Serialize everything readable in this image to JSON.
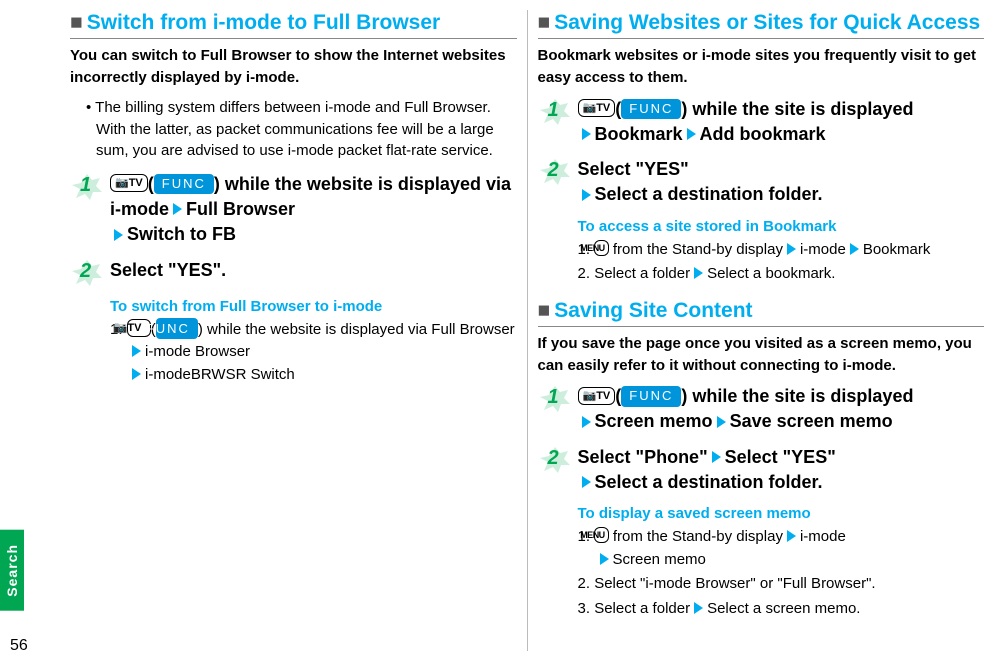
{
  "margin": {
    "tab": "Search",
    "pageNumber": "56"
  },
  "left": {
    "title": "Switch from i-mode to Full Browser",
    "intro": "You can switch to Full Browser to show the Internet websites incorrectly displayed by i-mode.",
    "bullet": "The billing system differs between i-mode and Full Browser. With the latter, as packet communications fee will be a large sum, you are advised to use i-mode packet flat-rate service.",
    "step1_a": " while the website is displayed via i-mode",
    "step1_b": "Full Browser",
    "step1_c": "Switch to FB",
    "step2": "Select \"YES\".",
    "subTitle": "To switch from Full Browser to i-mode",
    "subStep1_a": " while the website is displayed via Full Browser",
    "subStep1_b": "i-mode Browser",
    "subStep1_c": "i-modeBRWSR Switch"
  },
  "r1": {
    "title": "Saving Websites or Sites for Quick Access",
    "intro": "Bookmark websites or i-mode sites you frequently visit to get easy access to them.",
    "step1_a": " while the site is displayed",
    "step1_b": "Bookmark",
    "step1_c": "Add bookmark",
    "step2_a": "Select \"YES\"",
    "step2_b": "Select a destination folder.",
    "subTitle": "To access a site stored in Bookmark",
    "subStep1_a": " from the Stand-by display",
    "subStep1_b": "i-mode",
    "subStep1_c": "Bookmark",
    "subStep2_a": "Select a folder",
    "subStep2_b": "Select a bookmark."
  },
  "r2": {
    "title": "Saving Site Content",
    "intro": "If you save the page once you visited as a screen memo, you can easily refer to it without connecting to i-mode.",
    "step1_a": " while the site is displayed",
    "step1_b": "Screen memo",
    "step1_c": "Save screen memo",
    "step2_a": "Select \"Phone\"",
    "step2_b": "Select \"YES\"",
    "step2_c": "Select a destination folder.",
    "subTitle": "To display a saved screen memo",
    "subStep1_a": " from the Stand-by display",
    "subStep1_b": "i-mode",
    "subStep1_c": "Screen memo",
    "subStep2": "Select \"i-mode Browser\" or \"Full Browser\".",
    "subStep3_a": "Select a folder",
    "subStep3_b": "Select a screen memo."
  },
  "labels": {
    "func": "FUNC",
    "cam": "📷TV",
    "menu": "MENU",
    "one": "1.",
    "two": "2.",
    "three": "3.",
    "sq": "■"
  }
}
